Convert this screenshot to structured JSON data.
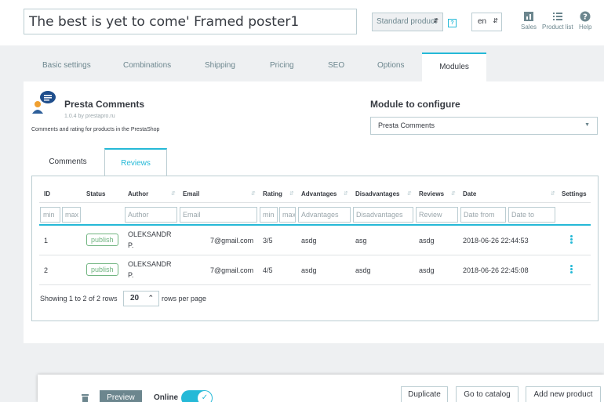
{
  "header": {
    "product_name": "The best is yet to come' Framed poster1",
    "product_type": "Standard product",
    "language": "en",
    "tools": [
      {
        "label": "Sales",
        "icon": "chart-icon"
      },
      {
        "label": "Product list",
        "icon": "list-icon"
      },
      {
        "label": "Help",
        "icon": "help-icon"
      }
    ]
  },
  "tabs": [
    {
      "label": "Basic settings"
    },
    {
      "label": "Combinations"
    },
    {
      "label": "Shipping"
    },
    {
      "label": "Pricing"
    },
    {
      "label": "SEO"
    },
    {
      "label": "Options"
    },
    {
      "label": "Modules",
      "active": true
    }
  ],
  "module": {
    "name": "Presta Comments",
    "version": "1.0.4 by prestapro.ru",
    "description": "Comments and rating for products in the PrestaShop",
    "configure_title": "Module to configure",
    "configure_selected": "Presta Comments"
  },
  "subtabs": {
    "comments": "Comments",
    "reviews": "Reviews"
  },
  "table": {
    "columns": [
      "ID",
      "Status",
      "Author",
      "Email",
      "Rating",
      "Advantages",
      "Disadvantages",
      "Reviews",
      "Date",
      "Settings"
    ],
    "filters": {
      "id_min": "min",
      "id_max": "max",
      "author": "Author",
      "email": "Email",
      "rating_min": "min",
      "rating_max": "max",
      "advantages": "Advantages",
      "disadvantages": "Disadvantages",
      "review": "Review",
      "date_from": "Date from",
      "date_to": "Date to"
    },
    "rows": [
      {
        "id": "1",
        "status": "publish",
        "author_line1": "OLEKSANDR",
        "author_line2": "P.",
        "email": "7@gmail.com",
        "rating": "3/5",
        "advantages": "asdg",
        "disadvantages": "asg",
        "reviews": "asdg",
        "date": "2018-06-26 22:44:53"
      },
      {
        "id": "2",
        "status": "publish",
        "author_line1": "OLEKSANDR",
        "author_line2": "P.",
        "email": "7@gmail.com",
        "rating": "4/5",
        "advantages": "asdg",
        "disadvantages": "asdg",
        "reviews": "asdg",
        "date": "2018-06-26 22:45:08"
      }
    ],
    "showing": "Showing 1 to 2 of 2 rows",
    "rows_per_page_value": "20",
    "rows_per_page_label": "rows per page"
  },
  "footer": {
    "preview": "Preview",
    "online": "Online",
    "duplicate": "Duplicate",
    "go_to_catalog": "Go to catalog",
    "add_new_product": "Add new product"
  },
  "colors": {
    "accent": "#25b9d7",
    "success": "#70b580",
    "text": "#363a41",
    "muted": "#6c868e"
  }
}
